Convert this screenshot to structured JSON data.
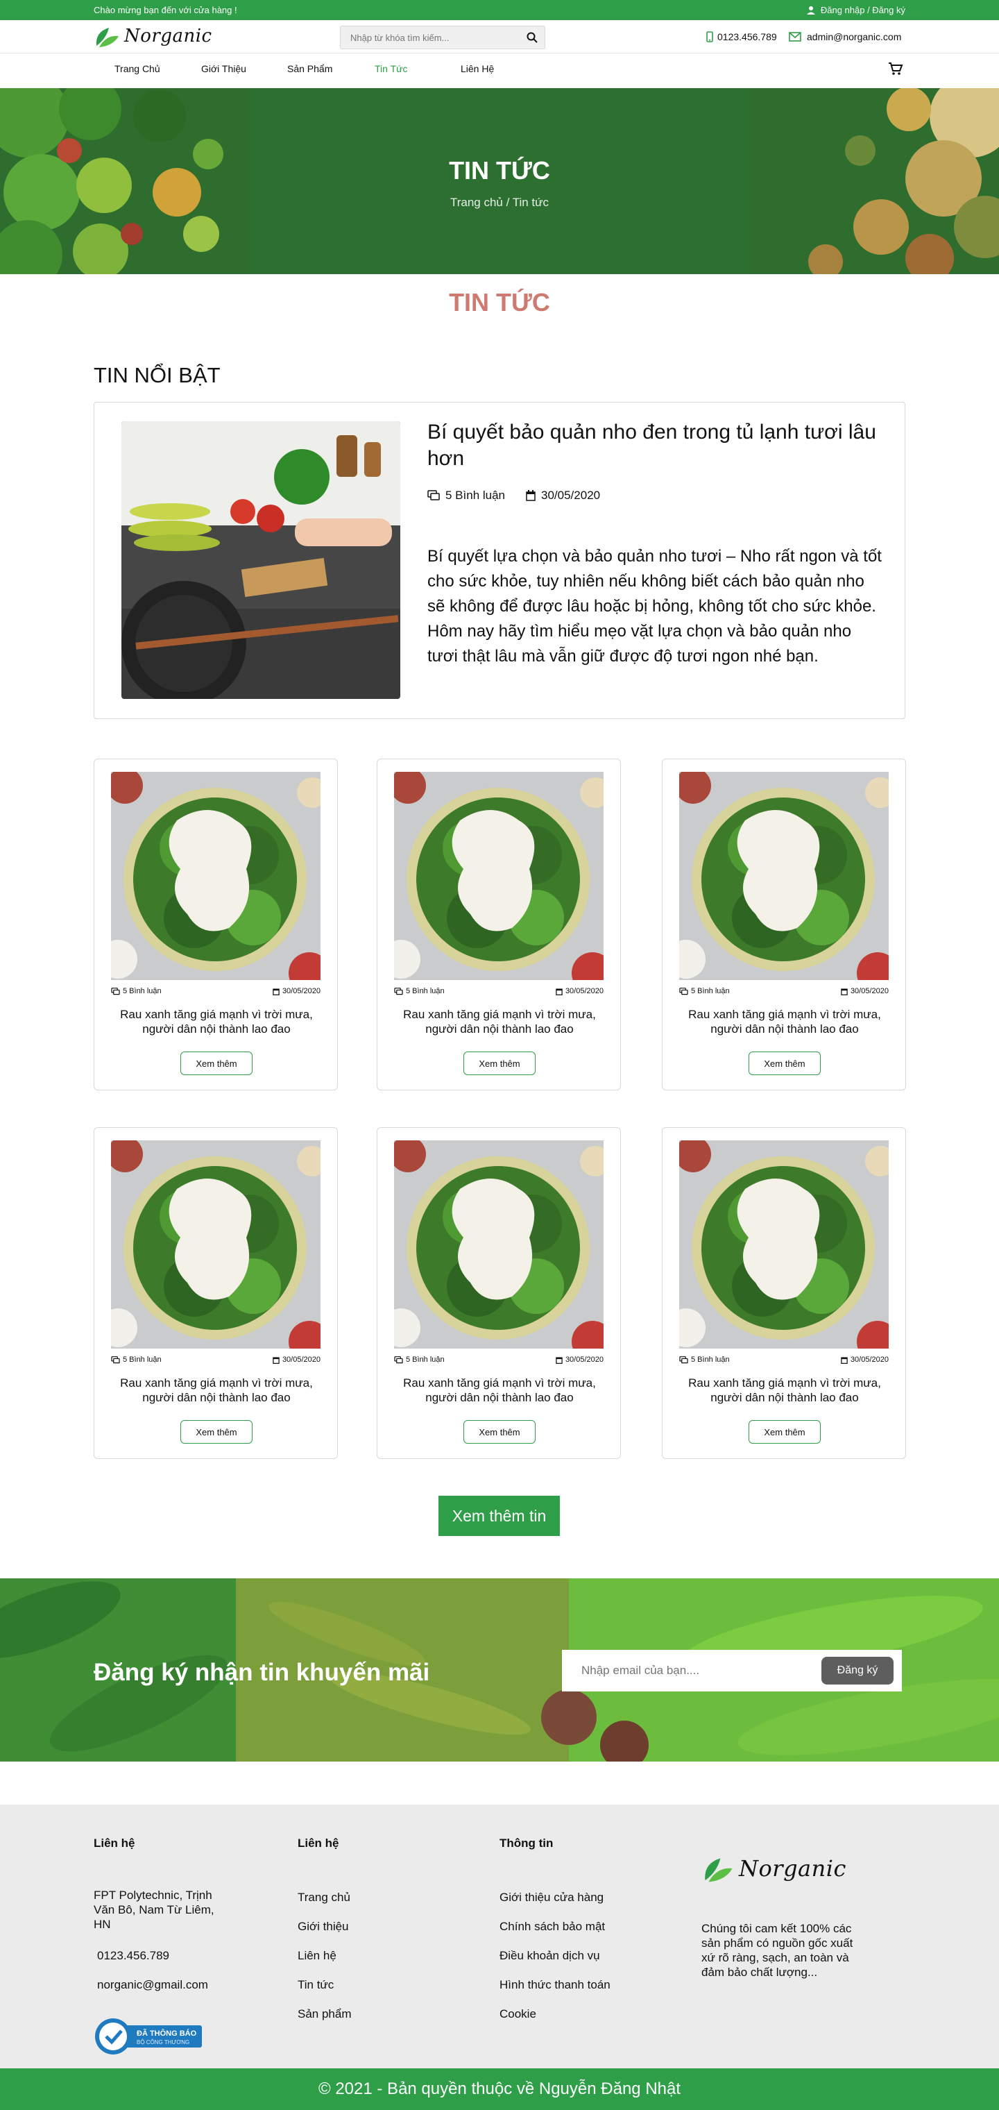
{
  "colors": {
    "brand_green": "#2e9e48",
    "section_title": "#ce7a70",
    "hero_overlay": "#2d6f31"
  },
  "topbar": {
    "welcome": "Chào mừng bạn đến với cửa hàng !",
    "auth": "Đăng nhập / Đăng ký",
    "auth_icon": "user-icon"
  },
  "header": {
    "logo": "Norganic",
    "search_placeholder": "Nhập từ khóa tìm kiếm...",
    "search_icon": "search-icon",
    "phone": "0123.456.789",
    "email": "admin@norganic.com"
  },
  "nav": {
    "items": [
      {
        "label": "Trang Chủ",
        "active": false
      },
      {
        "label": "Giới Thiệu",
        "active": false
      },
      {
        "label": "Sản Phẩm",
        "active": false
      },
      {
        "label": "Tin Tức",
        "active": true
      },
      {
        "label": "Liên Hệ",
        "active": false
      }
    ],
    "cart_icon": "cart-icon"
  },
  "hero": {
    "title": "TIN TỨC",
    "breadcrumb": "Trang chủ / Tin tức"
  },
  "section_title": "TIN TỨC",
  "featured": {
    "heading": "TIN NỔI BẬT",
    "title": "Bí quyết bảo quản nho đen trong tủ lạnh tươi lâu hơn",
    "comments": "5 Bình luận",
    "date": "30/05/2020",
    "description": "Bí quyết lựa chọn và bảo quản nho tươi – Nho rất ngon và tốt cho sức khỏe, tuy nhiên nếu không biết cách bảo quản nho sẽ không để được lâu hoặc bị hỏng,  không tốt cho sức khỏe. Hôm nay hãy tìm hiểu mẹo vặt lựa chọn và bảo quản nho tươi thật lâu mà vẫn giữ được độ tươi ngon nhé bạn."
  },
  "news": [
    {
      "comments": "5 Bình luận",
      "date": "30/05/2020",
      "title": "Rau xanh tăng giá mạnh vì trời mưa, người dân nội thành lao đao",
      "button": "Xem thêm"
    },
    {
      "comments": "5 Bình luận",
      "date": "30/05/2020",
      "title": "Rau xanh tăng giá mạnh vì trời mưa, người dân nội thành lao đao",
      "button": "Xem thêm"
    },
    {
      "comments": "5 Bình luận",
      "date": "30/05/2020",
      "title": "Rau xanh tăng giá mạnh vì trời mưa, người dân nội thành lao đao",
      "button": "Xem thêm"
    },
    {
      "comments": "5 Bình luận",
      "date": "30/05/2020",
      "title": "Rau xanh tăng giá mạnh vì trời mưa, người dân nội thành lao đao",
      "button": "Xem thêm"
    },
    {
      "comments": "5 Bình luận",
      "date": "30/05/2020",
      "title": "Rau xanh tăng giá mạnh vì trời mưa, người dân nội thành lao đao",
      "button": "Xem thêm"
    },
    {
      "comments": "5 Bình luận",
      "date": "30/05/2020",
      "title": "Rau xanh tăng giá mạnh vì trời mưa, người dân nội thành lao đao",
      "button": "Xem thêm"
    }
  ],
  "load_more": "Xem thêm tin",
  "newsletter": {
    "title": "Đăng ký nhận tin khuyến mãi",
    "placeholder": "Nhập email của bạn....",
    "button": "Đăng ký"
  },
  "footer": {
    "col1": {
      "heading": "Liên hệ",
      "address": "FPT Polytechnic, Trịnh Văn Bô, Nam Từ Liêm, HN",
      "phone": "0123.456.789",
      "email": "norganic@gmail.com",
      "badge": "ĐÃ THÔNG BÁO",
      "badge_sub": "BỘ CÔNG THƯƠNG"
    },
    "col2": {
      "heading": "Liên hệ",
      "links": [
        "Trang chủ",
        "Giới thiệu",
        "Liên hệ",
        "Tin tức",
        "Sản phẩm"
      ]
    },
    "col3": {
      "heading": "Thông tin",
      "links": [
        "Giới thiệu cửa hàng",
        "Chính sách bảo mật",
        "Điều khoản dịch vụ",
        "Hình thức thanh toán",
        "Cookie"
      ]
    },
    "col4": {
      "logo": "Norganic",
      "description": "Chúng tôi cam kết 100% các sản phẩm có nguồn gốc xuất xứ rõ ràng, sạch, an toàn và đảm bảo chất lượng..."
    }
  },
  "copyright": "© 2021 - Bản quyền thuộc về Nguyễn Đăng Nhật"
}
